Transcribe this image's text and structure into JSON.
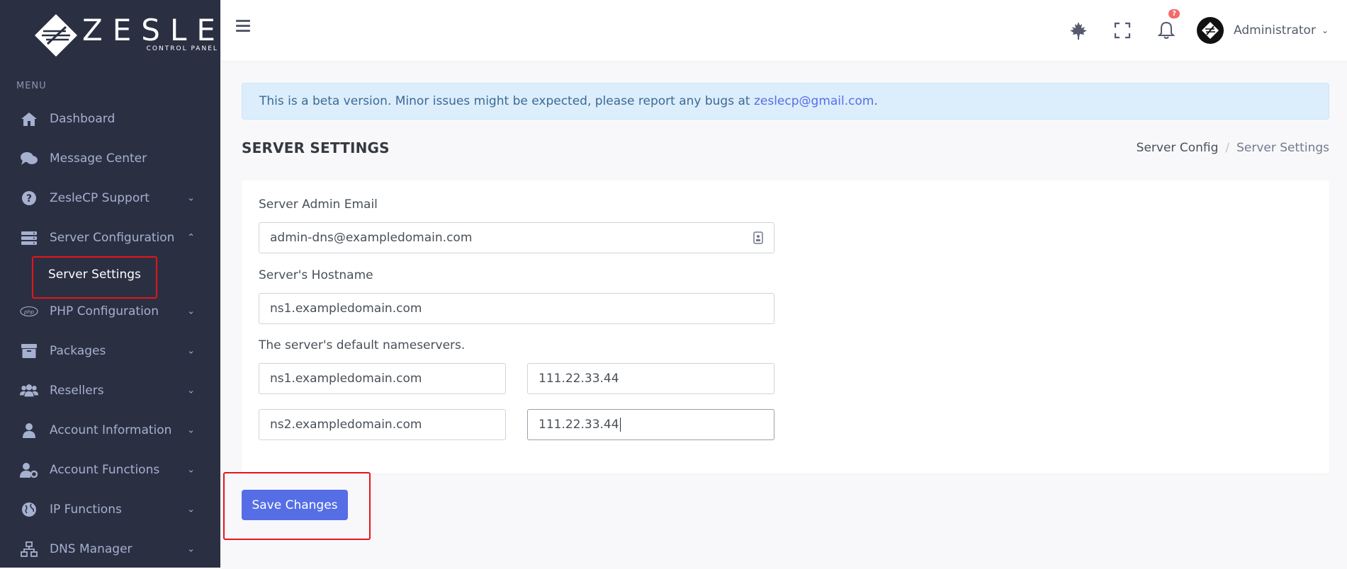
{
  "brand": {
    "name": "ZESLE",
    "tagline": "CONTROL PANEL"
  },
  "sidebar": {
    "menu_title": "MENU",
    "items": [
      {
        "label": "Dashboard",
        "icon": "home-icon",
        "has_children": false
      },
      {
        "label": "Message Center",
        "icon": "chat-icon",
        "has_children": false
      },
      {
        "label": "ZesleCP Support",
        "icon": "help-circle-icon",
        "has_children": true
      },
      {
        "label": "Server Configuration",
        "icon": "server-icon",
        "has_children": true,
        "expanded": true
      },
      {
        "label": "PHP Configuration",
        "icon": "php-icon",
        "has_children": true
      },
      {
        "label": "Packages",
        "icon": "box-icon",
        "has_children": true
      },
      {
        "label": "Resellers",
        "icon": "users-icon",
        "has_children": true
      },
      {
        "label": "Account Information",
        "icon": "user-icon",
        "has_children": true
      },
      {
        "label": "Account Functions",
        "icon": "user-cog-icon",
        "has_children": true
      },
      {
        "label": "IP Functions",
        "icon": "globe-icon",
        "has_children": true
      },
      {
        "label": "DNS Manager",
        "icon": "network-icon",
        "has_children": true
      }
    ],
    "sub_items": {
      "server_settings": "Server Settings"
    },
    "php_icon_text": "php"
  },
  "topbar": {
    "notification_badge": "?",
    "user_name": "Administrator"
  },
  "alert": {
    "text": "This is a beta version. Minor issues might be expected, please report any bugs at ",
    "email": "zeslecp@gmail.com",
    "suffix": "."
  },
  "page": {
    "title": "SERVER SETTINGS",
    "breadcrumb": [
      "Server Config",
      "Server Settings"
    ]
  },
  "form": {
    "admin_email_label": "Server Admin Email",
    "admin_email_value": "admin-dns@exampledomain.com",
    "hostname_label": "Server's Hostname",
    "hostname_value": "ns1.exampledomain.com",
    "nameservers_label": "The server's default nameservers.",
    "nameservers": [
      {
        "host": "ns1.exampledomain.com",
        "ip": "111.22.33.44"
      },
      {
        "host": "ns2.exampledomain.com",
        "ip": "111.22.33.44"
      }
    ]
  },
  "actions": {
    "save_label": "Save Changes"
  },
  "colors": {
    "sidebar_bg": "#2a3042",
    "accent": "#556ee6",
    "highlight_box": "#e6141b",
    "alert_bg": "#dcedfc"
  }
}
